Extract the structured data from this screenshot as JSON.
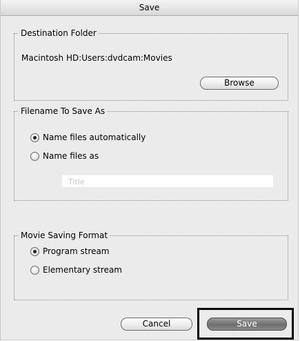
{
  "window": {
    "title": "Save"
  },
  "destination": {
    "legend": "Destination Folder",
    "path": "Macintosh HD:Users:dvdcam:Movies",
    "browse_label": "Browse"
  },
  "filename": {
    "legend": "Filename To Save As",
    "options": [
      {
        "label": "Name files automatically",
        "selected": true
      },
      {
        "label": "Name files as",
        "selected": false
      }
    ],
    "title_placeholder": "Title"
  },
  "format": {
    "legend": "Movie Saving Format",
    "options": [
      {
        "label": "Program stream",
        "selected": true
      },
      {
        "label": "Elementary stream",
        "selected": false
      }
    ]
  },
  "buttons": {
    "cancel_label": "Cancel",
    "save_label": "Save"
  }
}
